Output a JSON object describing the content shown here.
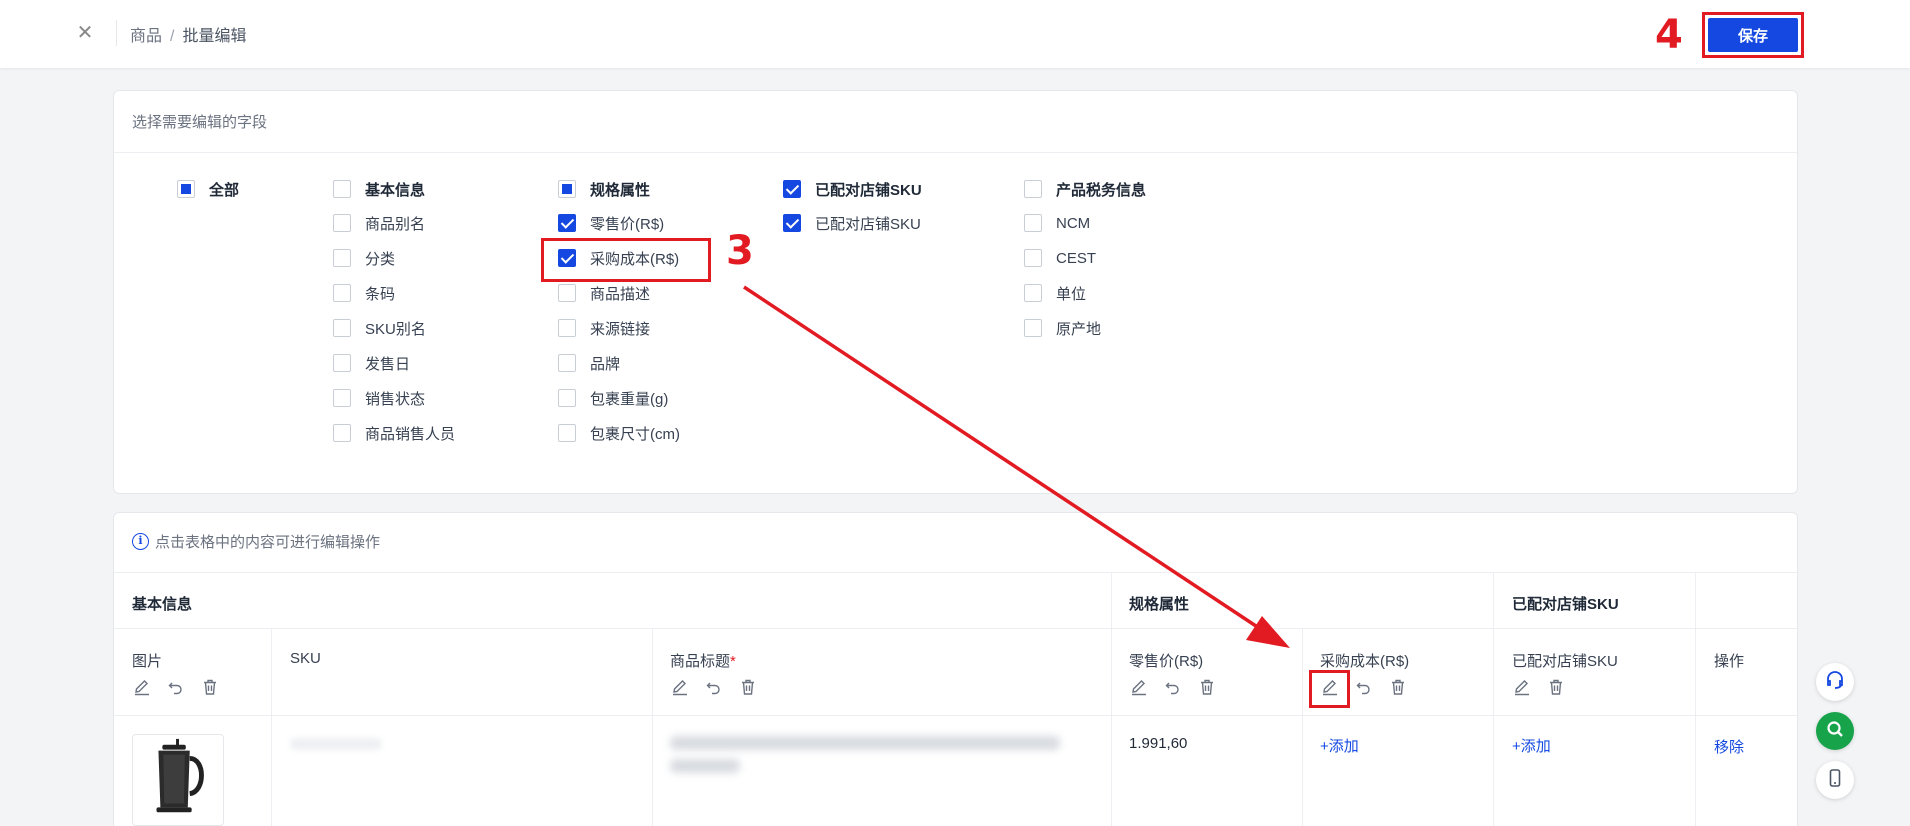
{
  "header": {
    "breadcrumb_parent": "商品",
    "breadcrumb_separator": "/",
    "breadcrumb_current": "批量编辑",
    "save_label": "保存",
    "annotation_step": "4"
  },
  "fields": {
    "title": "选择需要编辑的字段",
    "annotation_step": "3",
    "all": {
      "label": "全部",
      "state": "partial"
    },
    "groups": [
      {
        "header": "基本信息",
        "state": "unchecked",
        "items": [
          {
            "label": "商品别名",
            "checked": false
          },
          {
            "label": "分类",
            "checked": false
          },
          {
            "label": "条码",
            "checked": false
          },
          {
            "label": "SKU别名",
            "checked": false
          },
          {
            "label": "发售日",
            "checked": false
          },
          {
            "label": "销售状态",
            "checked": false
          },
          {
            "label": "商品销售人员",
            "checked": false
          }
        ]
      },
      {
        "header": "规格属性",
        "state": "partial",
        "items": [
          {
            "label": "零售价(R$)",
            "checked": true
          },
          {
            "label": "采购成本(R$)",
            "checked": true
          },
          {
            "label": "商品描述",
            "checked": false
          },
          {
            "label": "来源链接",
            "checked": false
          },
          {
            "label": "品牌",
            "checked": false
          },
          {
            "label": "包裹重量(g)",
            "checked": false
          },
          {
            "label": "包裹尺寸(cm)",
            "checked": false
          }
        ]
      },
      {
        "header": "已配对店铺SKU",
        "state": "checked",
        "items": [
          {
            "label": "已配对店铺SKU",
            "checked": true
          }
        ]
      },
      {
        "header": "产品税务信息",
        "state": "unchecked",
        "items": [
          {
            "label": "NCM",
            "checked": false
          },
          {
            "label": "CEST",
            "checked": false
          },
          {
            "label": "单位",
            "checked": false
          },
          {
            "label": "原产地",
            "checked": false
          }
        ]
      }
    ]
  },
  "table": {
    "tip": "点击表格中的内容可进行编辑操作",
    "groups": [
      "基本信息",
      "规格属性",
      "已配对店铺SKU"
    ],
    "columns": {
      "image": "图片",
      "sku": "SKU",
      "title": "商品标题",
      "required_mark": "*",
      "retail_price": "零售价(R$)",
      "purchase_cost": "采购成本(R$)",
      "paired_sku": "已配对店铺SKU",
      "actions": "操作"
    },
    "rows": [
      {
        "retail_price": "1.991,60",
        "purchase_cost_action": "+添加",
        "paired_sku_action": "+添加",
        "remove_action": "移除"
      }
    ]
  },
  "icons": [
    "close-icon",
    "info-icon",
    "edit-icon",
    "undo-icon",
    "delete-icon",
    "headset-icon",
    "search-icon",
    "phone-icon"
  ],
  "colors": {
    "primary": "#1448e0",
    "annotation": "#e21b23",
    "success": "#16a34a"
  }
}
